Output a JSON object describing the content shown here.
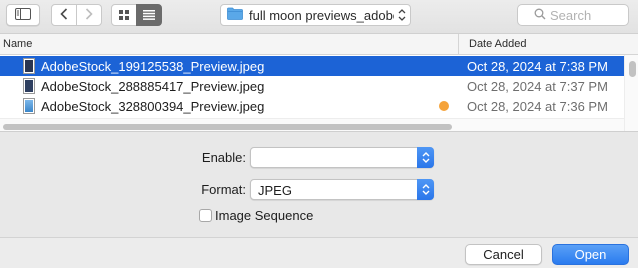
{
  "toolbar": {
    "location_name": "full moon previews_adobe",
    "search_placeholder": "Search"
  },
  "list": {
    "columns": {
      "name": "Name",
      "date_added": "Date Added"
    },
    "rows": [
      {
        "name": "AdobeStock_199125538_Preview.jpeg",
        "date": "Oct 28, 2024 at 7:38 PM",
        "selected": true,
        "thumb_color": "#2a3550"
      },
      {
        "name": "AdobeStock_288885417_Preview.jpeg",
        "date": "Oct 28, 2024 at 7:37 PM",
        "selected": false,
        "thumb_color": "#2e3f60"
      },
      {
        "name": "AdobeStock_328800394_Preview.jpeg",
        "date": "Oct 28, 2024 at 7:36 PM",
        "selected": false,
        "thumb_color": "#3a86c9",
        "tag_color": "#f5a33a"
      }
    ]
  },
  "options": {
    "enable_label": "Enable:",
    "enable_value": "",
    "format_label": "Format:",
    "format_value": "JPEG",
    "image_sequence_label": "Image Sequence",
    "image_sequence_checked": false
  },
  "buttons": {
    "cancel": "Cancel",
    "open": "Open"
  },
  "colors": {
    "selection": "#1c63d6",
    "accent": "#2a7bef",
    "folder": "#5aa8e8"
  }
}
